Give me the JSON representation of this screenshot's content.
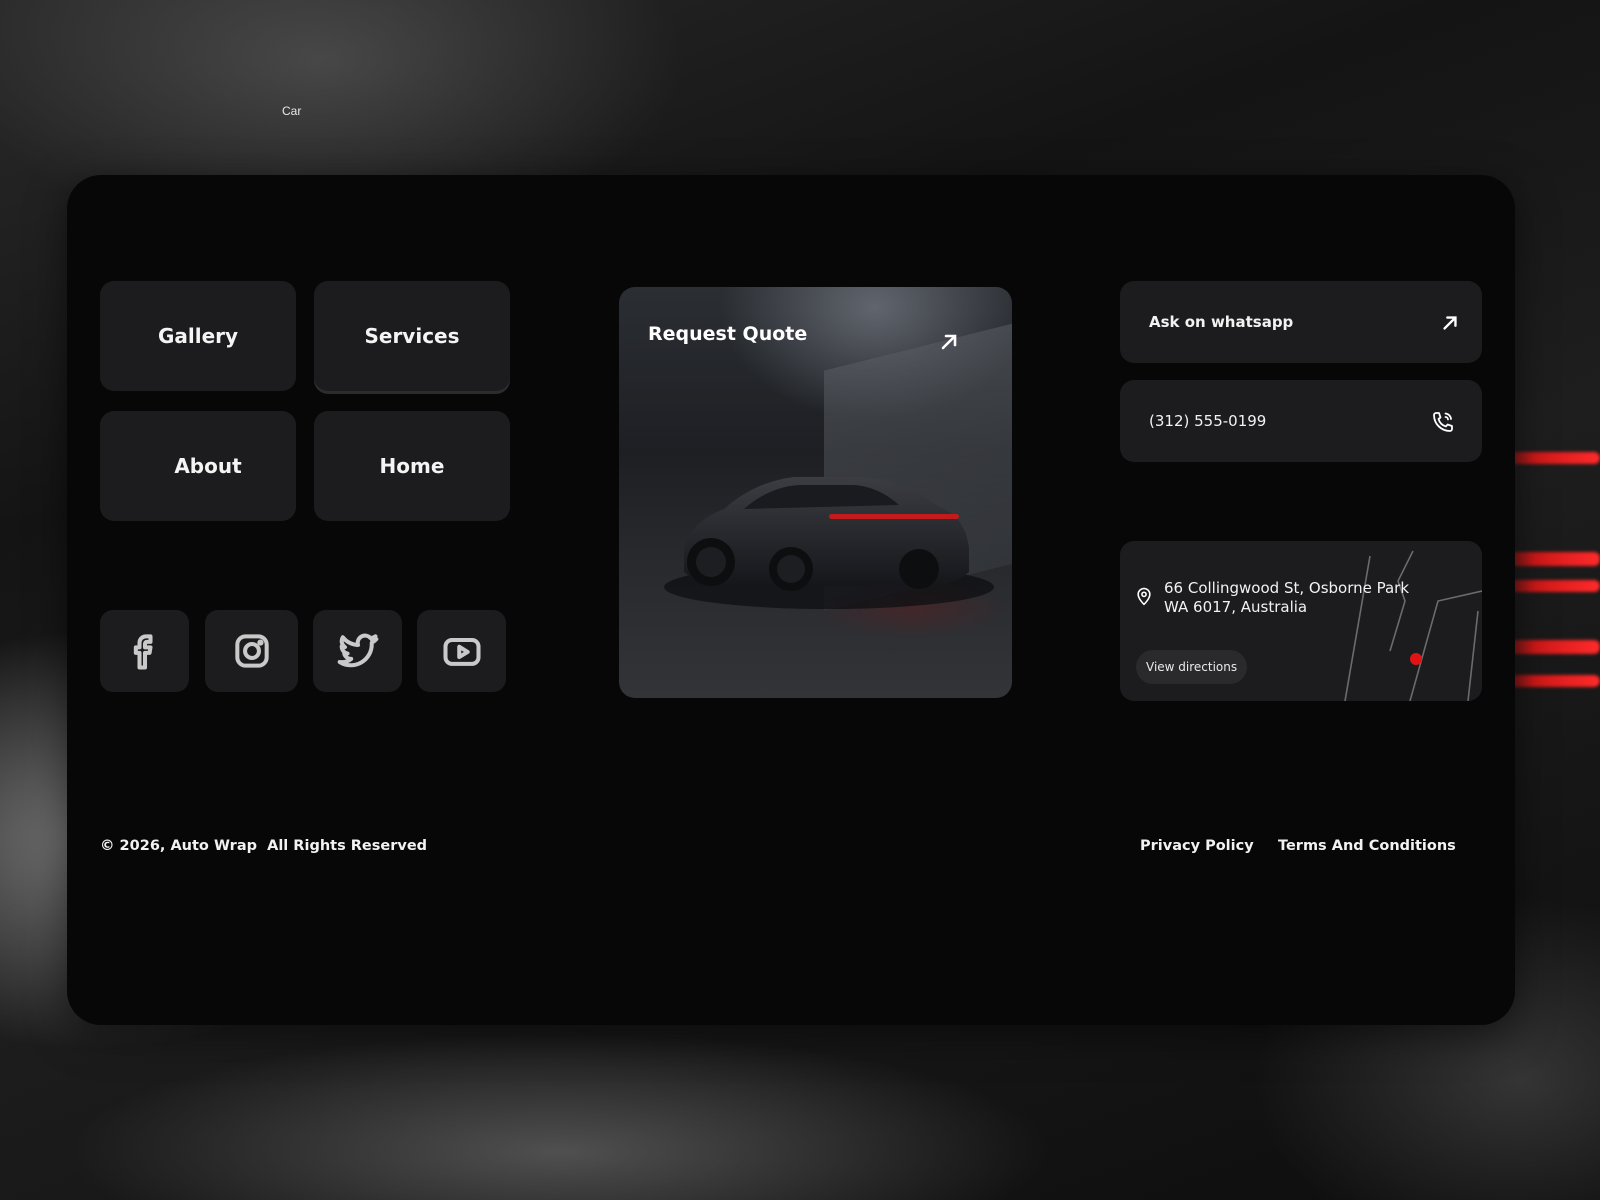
{
  "background_label": "Car",
  "nav": {
    "gallery": "Gallery",
    "services": "Services",
    "about": "About",
    "home": "Home"
  },
  "social": {
    "facebook_icon": "facebook-icon",
    "instagram_icon": "instagram-icon",
    "twitter_icon": "twitter-icon",
    "youtube_icon": "youtube-icon"
  },
  "quote": {
    "title": "Request Quote",
    "arrow_icon": "arrow-up-right-icon"
  },
  "contact": {
    "whatsapp_label": "Ask on whatsapp",
    "whatsapp_icon": "arrow-up-right-icon",
    "phone": "(312) 555-0199",
    "phone_icon": "phone-icon"
  },
  "location": {
    "address_line1": "66 Collingwood St, Osborne Park",
    "address_line2": "WA 6017, Australia",
    "pin_icon": "map-pin-icon",
    "directions_label": "View directions",
    "marker_color": "#e01414"
  },
  "footer": {
    "copyright": "© 2026, Auto Wrap  All Rights Reserved",
    "privacy": "Privacy Policy",
    "terms": "Terms And Conditions"
  },
  "colors": {
    "panel": "#070707",
    "card": "#1c1c1e",
    "accent_red": "#d01818"
  }
}
